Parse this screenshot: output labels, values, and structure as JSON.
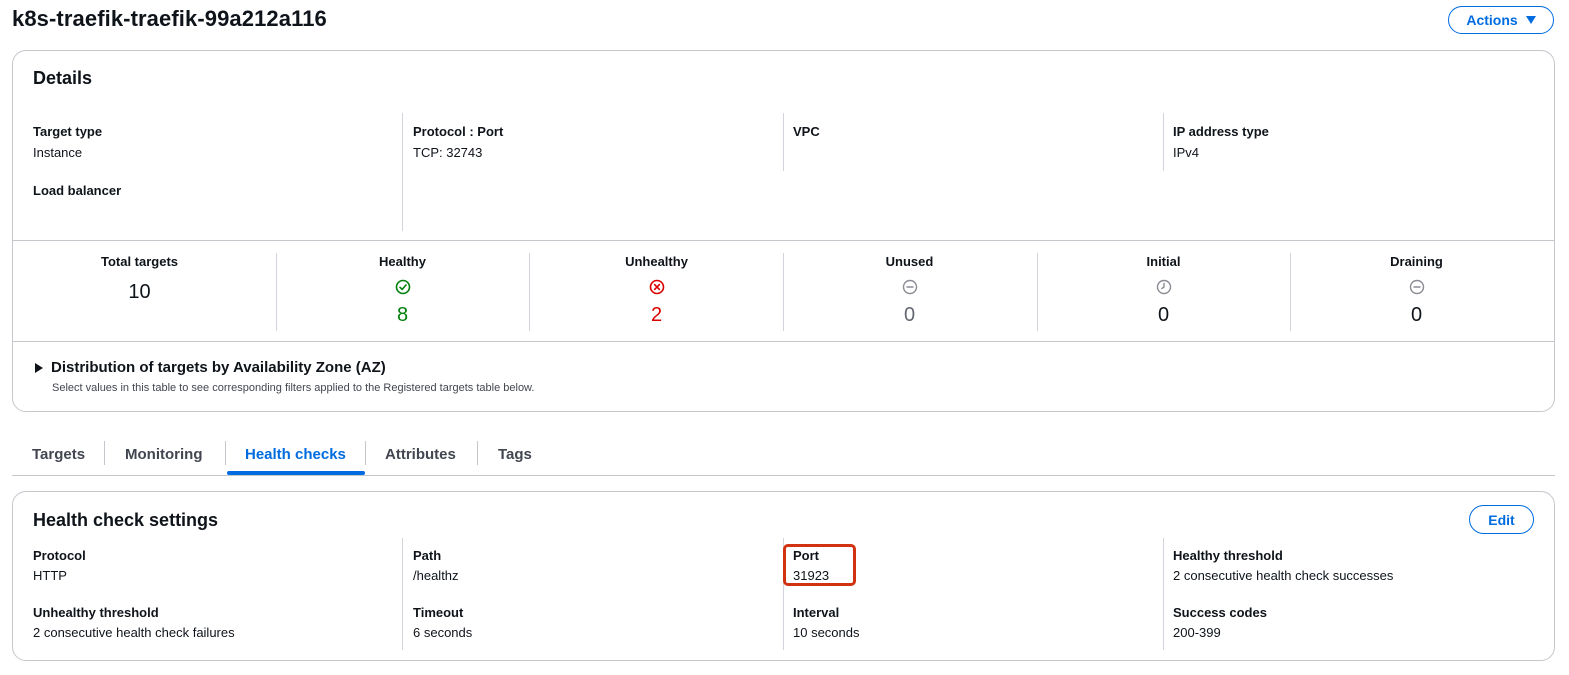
{
  "header": {
    "title": "k8s-traefik-traefik-99a212a116",
    "actions_label": "Actions"
  },
  "details": {
    "title": "Details",
    "fields": [
      {
        "label": "Target type",
        "value": "Instance"
      },
      {
        "label": "Protocol : Port",
        "value": "TCP: 32743"
      },
      {
        "label": "VPC",
        "value": ""
      },
      {
        "label": "IP address type",
        "value": "IPv4"
      },
      {
        "label": "Load balancer",
        "value": ""
      }
    ],
    "stats": [
      {
        "label": "Total targets",
        "value": "10",
        "icon": "",
        "color": "#0f141a"
      },
      {
        "label": "Healthy",
        "value": "8",
        "icon": "check-circle-icon",
        "color": "#037f0c"
      },
      {
        "label": "Unhealthy",
        "value": "2",
        "icon": "x-circle-icon",
        "color": "#db0000"
      },
      {
        "label": "Unused",
        "value": "0",
        "icon": "minus-circle-icon",
        "color": "#656871"
      },
      {
        "label": "Initial",
        "value": "0",
        "icon": "clock-icon",
        "color": "#0f141a"
      },
      {
        "label": "Draining",
        "value": "0",
        "icon": "minus-circle-icon",
        "color": "#0f141a"
      }
    ],
    "az": {
      "title": "Distribution of targets by Availability Zone (AZ)",
      "description": "Select values in this table to see corresponding filters applied to the Registered targets table below."
    }
  },
  "tabs": [
    {
      "label": "Targets",
      "active": false
    },
    {
      "label": "Monitoring",
      "active": false
    },
    {
      "label": "Health checks",
      "active": true
    },
    {
      "label": "Attributes",
      "active": false
    },
    {
      "label": "Tags",
      "active": false
    }
  ],
  "health_check": {
    "title": "Health check settings",
    "edit_label": "Edit",
    "fields": [
      {
        "label": "Protocol",
        "value": "HTTP"
      },
      {
        "label": "Path",
        "value": "/healthz"
      },
      {
        "label": "Port",
        "value": "31923"
      },
      {
        "label": "Healthy threshold",
        "value": "2 consecutive health check successes"
      },
      {
        "label": "Unhealthy threshold",
        "value": "2 consecutive health check failures"
      },
      {
        "label": "Timeout",
        "value": "6 seconds"
      },
      {
        "label": "Interval",
        "value": "10 seconds"
      },
      {
        "label": "Success codes",
        "value": "200-399"
      }
    ]
  },
  "colors": {
    "accent": "#006ce0",
    "healthy": "#037f0c",
    "unhealthy": "#db0000",
    "highlight": "#d13212"
  }
}
